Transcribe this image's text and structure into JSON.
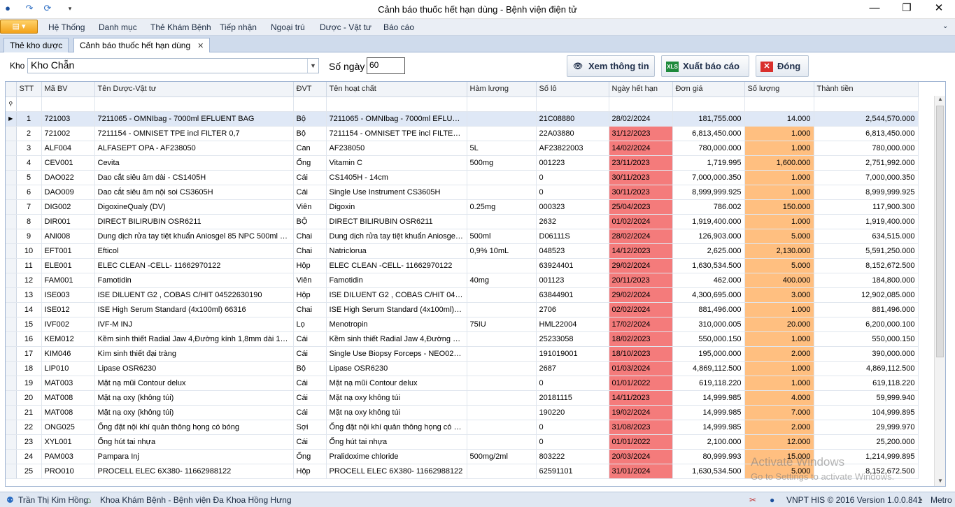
{
  "window": {
    "title": "Cảnh báo thuốc hết hạn dùng - Bệnh viện điện tử",
    "minimize": "—",
    "restore": "❐",
    "close": "✕"
  },
  "menu": {
    "items": [
      "Hệ Thống",
      "Danh mục",
      "Thẻ Khám Bệnh",
      "Tiếp nhận",
      "Ngoại trú",
      "Dược - Vật tư",
      "Báo cáo"
    ]
  },
  "tabs": [
    {
      "label": "Thẻ kho dược"
    },
    {
      "label": "Cảnh báo thuốc hết hạn dùng"
    }
  ],
  "toolbar": {
    "kho_label": "Kho",
    "kho_value": "Kho Chẵn",
    "songay_label": "Số ngày",
    "songay_value": "60",
    "view_label": "Xem thông tin",
    "export_label": "Xuất báo cáo",
    "close_label": "Đóng"
  },
  "colors": {
    "expired": "#f47b7b",
    "quantity": "#ffbf80",
    "selected_row": "#dfe8f6"
  },
  "grid": {
    "columns": [
      "STT",
      "Mã BV",
      "Tên Dược-Vật tư",
      "ĐVT",
      "Tên hoạt chất",
      "Hàm lượng",
      "Số lô",
      "Ngày hết hạn",
      "Đơn giá",
      "Số lượng",
      "Thành tiền"
    ],
    "rows": [
      [
        "1",
        "721003",
        "7211065 - OMNIbag - 7000ml EFLUENT BAG",
        "Bộ",
        "7211065 - OMNIbag - 7000ml EFLUENT BAG",
        "",
        "21C08880",
        "28/02/2024",
        "181,755.000",
        "14.000",
        "2,544,570.000"
      ],
      [
        "2",
        "721002",
        "7211154 - OMNISET TPE incl FILTER 0,7",
        "Bộ",
        "7211154 - OMNISET TPE incl FILTER 0,7",
        "",
        "22A03880",
        "31/12/2023",
        "6,813,450.000",
        "1.000",
        "6,813,450.000"
      ],
      [
        "3",
        "ALF004",
        "ALFASEPT OPA - AF238050",
        "Can",
        "AF238050",
        "5L",
        "AF23822003",
        "14/02/2024",
        "780,000.000",
        "1.000",
        "780,000.000"
      ],
      [
        "4",
        "CEV001",
        "Cevita",
        "Ống",
        "Vitamin C",
        "500mg",
        "001223",
        "23/11/2023",
        "1,719.995",
        "1,600.000",
        "2,751,992.000"
      ],
      [
        "5",
        "DAO022",
        "Dao cắt siêu âm dài  - CS1405H",
        "Cái",
        "CS1405H - 14cm",
        "",
        "0",
        "30/11/2023",
        "7,000,000.350",
        "1.000",
        "7,000,000.350"
      ],
      [
        "6",
        "DAO009",
        "Dao cắt siêu âm nội soi CS3605H",
        "Cái",
        "Single Use Instrument CS3605H",
        "",
        "0",
        "30/11/2023",
        "8,999,999.925",
        "1.000",
        "8,999,999.925"
      ],
      [
        "7",
        "DIG002",
        "DigoxineQualy (DV)",
        "Viên",
        "Digoxin",
        "0.25mg",
        "000323",
        "25/04/2023",
        "786.002",
        "150.000",
        "117,900.300"
      ],
      [
        "8",
        "DIR001",
        "DIRECT BILIRUBIN OSR6211",
        "BỘ",
        "DIRECT BILIRUBIN OSR6211",
        "",
        "2632",
        "01/02/2024",
        "1,919,400.000",
        "1.000",
        "1,919,400.000"
      ],
      [
        "9",
        "ANI008",
        "Dung dịch rửa tay tiệt khuẩn Aniosgel 85 NPC 500ml - ...",
        "Chai",
        "Dung dịch rửa tay tiệt khuẩn Aniosgel 85 NPC 500ml",
        "500ml",
        "D06111S",
        "28/02/2024",
        "126,903.000",
        "5.000",
        "634,515.000"
      ],
      [
        "10",
        "EFT001",
        "Efticol",
        "Chai",
        "Natriclorua",
        "0,9% 10mL",
        "048523",
        "14/12/2023",
        "2,625.000",
        "2,130.000",
        "5,591,250.000"
      ],
      [
        "11",
        "ELE001",
        "ELEC CLEAN -CELL- 11662970122",
        "Hộp",
        "ELEC CLEAN -CELL- 11662970122",
        "",
        "63924401",
        "29/02/2024",
        "1,630,534.500",
        "5.000",
        "8,152,672.500"
      ],
      [
        "12",
        "FAM001",
        "Famotidin",
        "Viên",
        "Famotidin",
        "40mg",
        "001123",
        "20/11/2023",
        "462.000",
        "400.000",
        "184,800.000"
      ],
      [
        "13",
        "ISE003",
        "ISE DILUENT G2 , COBAS C/HIT 04522630190",
        "Hộp",
        "ISE DILUENT G2 , COBAS C/HIT 04522630190",
        "",
        "63844901",
        "29/02/2024",
        "4,300,695.000",
        "3.000",
        "12,902,085.000"
      ],
      [
        "14",
        "ISE012",
        "ISE High Serum Standard (4x100ml) 66316",
        "Chai",
        "ISE High Serum Standard (4x100ml) 66316",
        "",
        "2706",
        "02/02/2024",
        "881,496.000",
        "1.000",
        "881,496.000"
      ],
      [
        "15",
        "IVF002",
        "IVF-M INJ",
        "Lọ",
        "Menotropin",
        "75IU",
        "HML22004",
        "17/02/2024",
        "310,000.005",
        "20.000",
        "6,200,000.100"
      ],
      [
        "16",
        "KEM012",
        "Kềm sinh thiết Radial Jaw 4,Đường kính 1,8mm dài 100...",
        "Cái",
        "Kềm sinh thiết Radial Jaw 4,Đường kính 1,8mm",
        "",
        "25233058",
        "18/02/2023",
        "550,000.150",
        "1.000",
        "550,000.150"
      ],
      [
        "17",
        "KIM046",
        "Kìm sinh thiết đại tràng",
        "Cái",
        "Single Use Biopsy Forceps - NEO0222...",
        "",
        "191019001",
        "18/10/2023",
        "195,000.000",
        "2.000",
        "390,000.000"
      ],
      [
        "18",
        "LIP010",
        "Lipase OSR6230",
        "Bộ",
        "Lipase OSR6230",
        "",
        "2687",
        "01/03/2024",
        "4,869,112.500",
        "1.000",
        "4,869,112.500"
      ],
      [
        "19",
        "MAT003",
        "Mặt nạ mũi Contour delux",
        "Cái",
        "Mặt nạ mũi Contour delux",
        "",
        "0",
        "01/01/2022",
        "619,118.220",
        "1.000",
        "619,118.220"
      ],
      [
        "20",
        "MAT008",
        "Mặt nạ oxy (không túi)",
        "Cái",
        "Mặt nạ oxy không túi",
        "",
        "20181115",
        "14/11/2023",
        "14,999.985",
        "4.000",
        "59,999.940"
      ],
      [
        "21",
        "MAT008",
        "Mặt nạ oxy (không túi)",
        "Cái",
        "Mặt nạ oxy không túi",
        "",
        "190220",
        "19/02/2024",
        "14,999.985",
        "7.000",
        "104,999.895"
      ],
      [
        "22",
        "ONG025",
        "Ống đặt nội khí quản thông họng có bóng",
        "Sợi",
        "Ống đặt nội khí quản thông họng có bóng",
        "",
        "0",
        "31/08/2023",
        "14,999.985",
        "2.000",
        "29,999.970"
      ],
      [
        "23",
        "XYL001",
        "Ống hút tai nhựa",
        "Cái",
        "Ống hút tai nhựa",
        "",
        "0",
        "01/01/2022",
        "2,100.000",
        "12.000",
        "25,200.000"
      ],
      [
        "24",
        "PAM003",
        "Pampara Inj",
        "Ống",
        "Pralidoxime chloride",
        "500mg/2ml",
        "803222",
        "20/03/2024",
        "80,999.993",
        "15.000",
        "1,214,999.895"
      ],
      [
        "25",
        "PRO010",
        "PROCELL ELEC 6X380- 11662988122",
        "Hộp",
        "PROCELL ELEC 6X380- 11662988122",
        "",
        "62591101",
        "31/01/2024",
        "1,630,534.500",
        "5.000",
        "8,152,672.500"
      ]
    ]
  },
  "watermark": {
    "line1": "Activate Windows",
    "line2": "Go to Settings to activate Windows."
  },
  "status": {
    "user": "Trần Thị Kim Hồng",
    "department": "Khoa Khám Bệnh  -  Bệnh viện Đa Khoa Hồng Hưng",
    "version": "VNPT HIS © 2016 Version 1.0.0.841",
    "theme": "Metro"
  }
}
